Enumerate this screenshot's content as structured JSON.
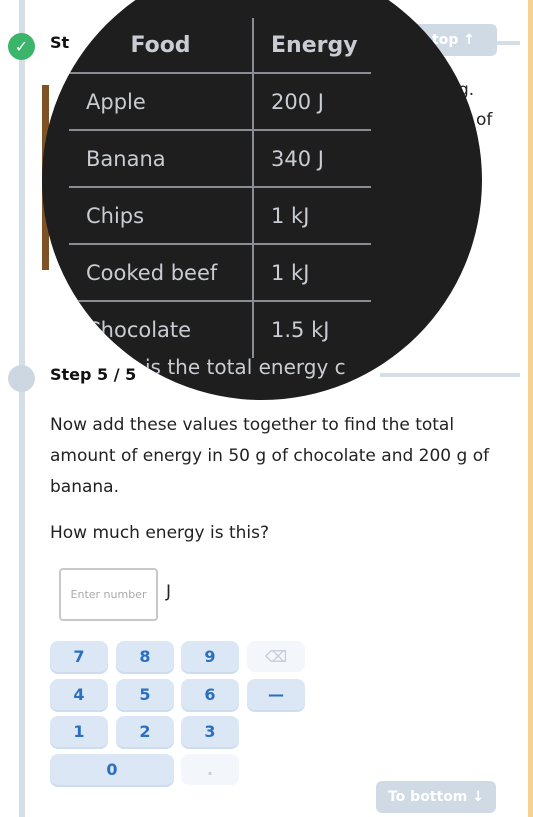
{
  "steps": {
    "prev_title_fragment": "St",
    "current_title": "Step 5 / 5",
    "current_title_fragment": "is the total energy c"
  },
  "background_fragments": [
    "g.",
    "of"
  ],
  "nav": {
    "to_top": "top",
    "to_top_icon": "↑",
    "to_bottom": "To bottom",
    "to_bottom_icon": "↓"
  },
  "table": {
    "headers": [
      "Food",
      "Energy"
    ],
    "rows": [
      [
        "Apple",
        "200 J"
      ],
      [
        "Banana",
        "340 J"
      ],
      [
        "Chips",
        "1 kJ"
      ],
      [
        "Cooked beef",
        "1 kJ"
      ],
      [
        "Chocolate",
        "1.5 kJ"
      ]
    ]
  },
  "question": {
    "instruction": "Now add these values together to find the total amount of energy in 50 g of chocolate and 200 g of banana.",
    "prompt": "How much energy is this?"
  },
  "answer": {
    "placeholder": "Enter number",
    "value": "",
    "unit": "J"
  },
  "keypad": {
    "keys": [
      "7",
      "8",
      "9",
      "4",
      "5",
      "6",
      "—",
      "1",
      "2",
      "3",
      "0",
      "."
    ],
    "backspace_icon": "backspace-icon"
  },
  "colors": {
    "done": "#3bb56a",
    "key_bg": "#dbe7f5",
    "key_text": "#2a6fc0",
    "magnifier": "#1e1e1e"
  }
}
